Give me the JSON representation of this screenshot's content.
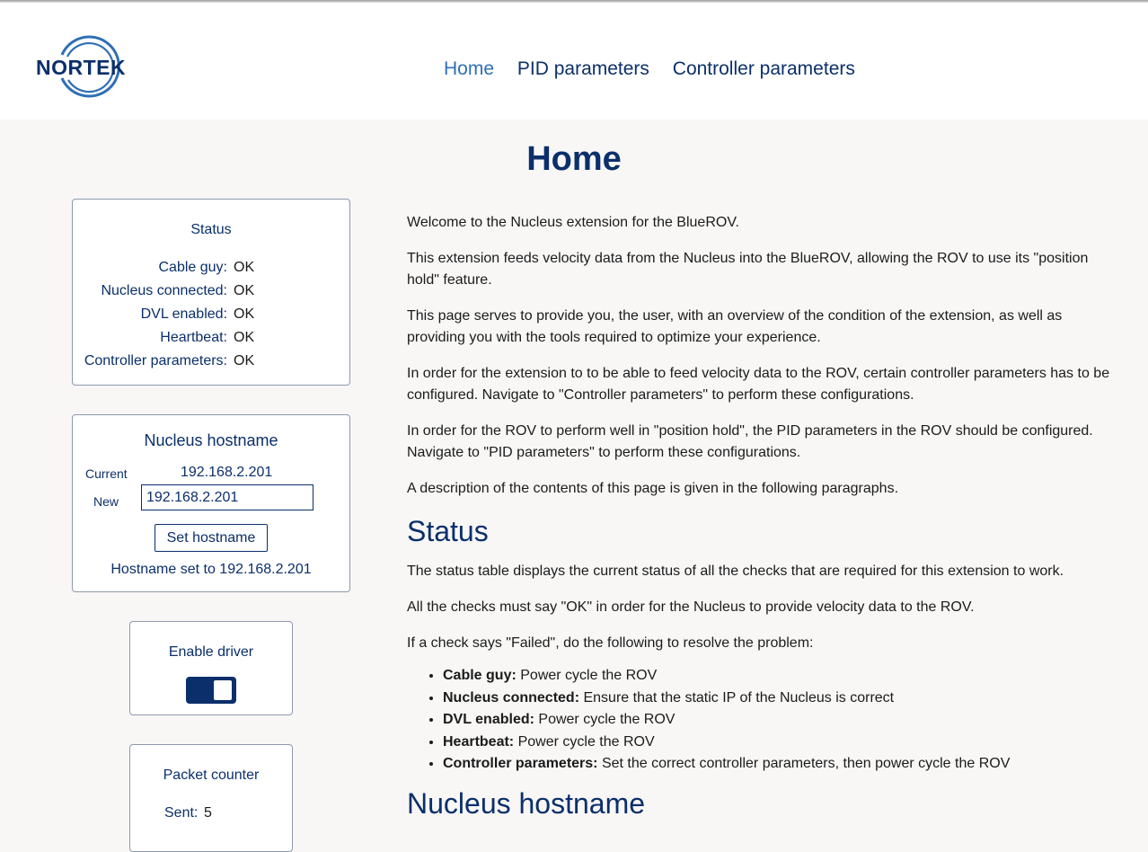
{
  "brand": {
    "name": "NORTEK"
  },
  "nav": [
    {
      "label": "Home",
      "active": true
    },
    {
      "label": "PID parameters",
      "active": false
    },
    {
      "label": "Controller parameters",
      "active": false
    }
  ],
  "page_title": "Home",
  "status_panel": {
    "title": "Status",
    "rows": [
      {
        "label": "Cable guy:",
        "value": "OK"
      },
      {
        "label": "Nucleus connected:",
        "value": "OK"
      },
      {
        "label": "DVL enabled:",
        "value": "OK"
      },
      {
        "label": "Heartbeat:",
        "value": "OK"
      },
      {
        "label": "Controller parameters:",
        "value": "OK"
      }
    ]
  },
  "hostname_panel": {
    "title": "Nucleus hostname",
    "current_label": "Current",
    "current_value": "192.168.2.201",
    "new_label": "New",
    "new_value": "192.168.2.201",
    "button_label": "Set hostname",
    "message": "Hostname set to 192.168.2.201"
  },
  "driver_panel": {
    "title": "Enable driver",
    "enabled": true
  },
  "packet_panel": {
    "title": "Packet counter",
    "sent_label": "Sent:",
    "sent_value": "5"
  },
  "content": {
    "intro": [
      "Welcome to the Nucleus extension for the BlueROV.",
      "This extension feeds velocity data from the Nucleus into the BlueROV, allowing the ROV to use its \"position hold\" feature.",
      "This page serves to provide you, the user, with an overview of the condition of the extension, as well as providing you with the tools required to optimize your experience.",
      "In order for the extension to to be able to feed velocity data to the ROV, certain controller parameters has to be configured. Navigate to \"Controller parameters\" to perform these configurations.",
      "In order for the ROV to perform well in \"position hold\", the PID parameters in the ROV should be configured. Navigate to \"PID parameters\" to perform these configurations.",
      "A description of the contents of this page is given in the following paragraphs."
    ],
    "status_heading": "Status",
    "status_paragraphs": [
      "The status table displays the current status of all the checks that are required for this extension to work.",
      "All the checks must say \"OK\" in order for the Nucleus to provide velocity data to the ROV.",
      "If a check says \"Failed\", do the following to resolve the problem:"
    ],
    "status_fixes": [
      {
        "term": "Cable guy:",
        "desc": " Power cycle the ROV"
      },
      {
        "term": "Nucleus connected:",
        "desc": " Ensure that the static IP of the Nucleus is correct"
      },
      {
        "term": "DVL enabled:",
        "desc": " Power cycle the ROV"
      },
      {
        "term": "Heartbeat:",
        "desc": " Power cycle the ROV"
      },
      {
        "term": "Controller parameters:",
        "desc": " Set the correct controller parameters, then power cycle the ROV"
      }
    ],
    "hostname_heading": "Nucleus hostname"
  },
  "colors": {
    "navy": "#0b2f6b",
    "accent": "#2f6fb5",
    "background": "#f8f7f6"
  }
}
